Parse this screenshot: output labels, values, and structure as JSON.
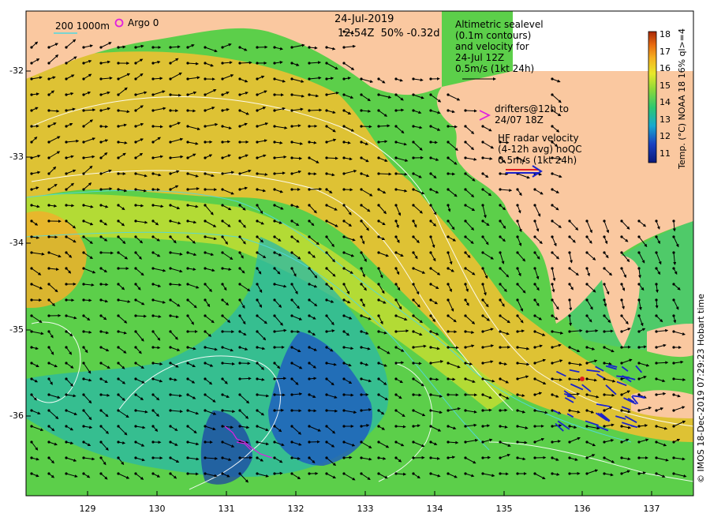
{
  "map": {
    "date": "24-Jul-2019",
    "time_info": "12:54Z  50% -0.32d",
    "bathy_legend": "200  1000m",
    "argo_label": "Argo 0",
    "altimetry_label_lines": [
      "Altimetric sealevel",
      "(0.1m contours)",
      "and velocity for",
      "24-Jul 12Z",
      "0.5m/s (1kt 24h)"
    ],
    "drifters_label_lines": [
      "drifters@12h to",
      "24/07 18Z"
    ],
    "hf_label_lines": [
      "HF radar velocity",
      "(4-12h avg) noQC",
      "0.5m/s (1kt 24h)"
    ],
    "colorbar_title": "Temp. (°C) NOAA 18 16% ql>=4",
    "credit": "© IMOS 18-Dec-2019 07:29:23 Hobart time",
    "colors": {
      "land": "#fac8a0",
      "ocean_warm": "#f5b82a",
      "ocean_mid": "#6fd24a",
      "ocean_cool": "#22b8c8",
      "ocean_cold": "#1a3aa8",
      "hf_radar": "#1a22cc",
      "drifter": "#e020e0"
    },
    "x_ticks": [
      "129",
      "130",
      "131",
      "132",
      "133",
      "134",
      "135",
      "136",
      "137"
    ],
    "y_ticks": [
      "-32",
      "-33",
      "-34",
      "-35",
      "-36"
    ],
    "colorbar_ticks": [
      "18",
      "17",
      "16",
      "15",
      "14",
      "13",
      "12",
      "11"
    ]
  }
}
